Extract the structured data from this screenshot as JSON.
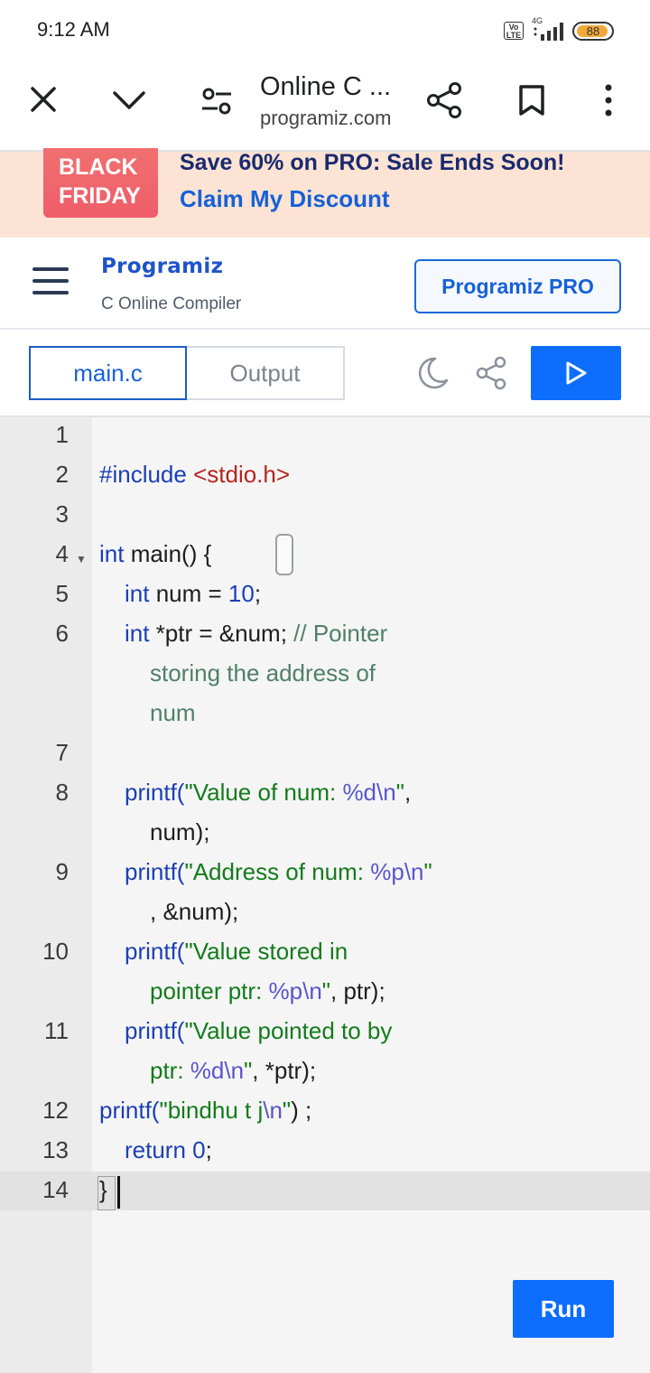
{
  "status_bar": {
    "time": "9:12 AM",
    "volte": "Vo LTE",
    "network": "4G",
    "battery": "88"
  },
  "browser": {
    "title": "Online C ...",
    "url": "programiz.com"
  },
  "promo": {
    "badge_line1": "BLACK",
    "badge_line2": "FRIDAY",
    "text": "Save 60% on PRO: Sale Ends Soon!",
    "link": "Claim My Discount"
  },
  "site": {
    "logo": "Programiz",
    "subtitle": "C Online Compiler",
    "pro_button": "Programiz PRO"
  },
  "tabs": {
    "main": "main.c",
    "output": "Output"
  },
  "editor": {
    "line_numbers": [
      "1",
      "2",
      "3",
      "4",
      "5",
      "6",
      "7",
      "8",
      "9",
      "10",
      "11",
      "12",
      "13",
      "14"
    ],
    "lines": [
      {
        "number": "1",
        "segments": []
      },
      {
        "number": "2",
        "segments": [
          {
            "t": "#include ",
            "c": "pre"
          },
          {
            "t": "<stdio.h>",
            "c": "inc"
          }
        ]
      },
      {
        "number": "3",
        "segments": []
      },
      {
        "number": "4",
        "segments": [
          {
            "t": "int",
            "c": "kw"
          },
          {
            "t": " main() {",
            "c": ""
          }
        ]
      },
      {
        "number": "5",
        "segments": [
          {
            "t": "int",
            "c": "kw"
          },
          {
            "t": " num = ",
            "c": ""
          },
          {
            "t": "10",
            "c": "num"
          },
          {
            "t": ";",
            "c": ""
          }
        ]
      },
      {
        "number": "6",
        "segments": [
          {
            "t": "int",
            "c": "kw"
          },
          {
            "t": " *ptr = &num; ",
            "c": ""
          },
          {
            "t": "// Pointer",
            "c": "cm"
          }
        ]
      },
      {
        "number": "",
        "segments": [
          {
            "t": "storing the address of",
            "c": "cm"
          }
        ]
      },
      {
        "number": "",
        "segments": [
          {
            "t": "num",
            "c": "cm"
          }
        ]
      },
      {
        "number": "7",
        "segments": []
      },
      {
        "number": "8",
        "segments": [
          {
            "t": "printf(",
            "c": "kw"
          },
          {
            "t": "\"Value of num: ",
            "c": "str"
          },
          {
            "t": "%d\\n",
            "c": "esc"
          },
          {
            "t": "\"",
            "c": "str"
          },
          {
            "t": ",",
            "c": ""
          }
        ]
      },
      {
        "number": "",
        "segments": [
          {
            "t": "num);",
            "c": ""
          }
        ]
      },
      {
        "number": "9",
        "segments": [
          {
            "t": "printf(",
            "c": "kw"
          },
          {
            "t": "\"Address of num: ",
            "c": "str"
          },
          {
            "t": "%p\\n",
            "c": "esc"
          },
          {
            "t": "\"",
            "c": "str"
          }
        ]
      },
      {
        "number": "",
        "segments": [
          {
            "t": ", &num);",
            "c": ""
          }
        ]
      },
      {
        "number": "10",
        "segments": [
          {
            "t": "printf(",
            "c": "kw"
          },
          {
            "t": "\"Value stored in",
            "c": "str"
          }
        ]
      },
      {
        "number": "",
        "segments": [
          {
            "t": "pointer ptr: ",
            "c": "str"
          },
          {
            "t": "%p\\n",
            "c": "esc"
          },
          {
            "t": "\"",
            "c": "str"
          },
          {
            "t": ", ptr);",
            "c": ""
          }
        ]
      },
      {
        "number": "11",
        "segments": [
          {
            "t": "printf(",
            "c": "kw"
          },
          {
            "t": "\"Value pointed to by",
            "c": "str"
          }
        ]
      },
      {
        "number": "",
        "segments": [
          {
            "t": "ptr: ",
            "c": "str"
          },
          {
            "t": "%d\\n",
            "c": "esc"
          },
          {
            "t": "\"",
            "c": "str"
          },
          {
            "t": ", *ptr);",
            "c": ""
          }
        ]
      },
      {
        "number": "12",
        "segments": [
          {
            "t": "printf(",
            "c": "kw"
          },
          {
            "t": "\"bindhu t j",
            "c": "str"
          },
          {
            "t": "\\n",
            "c": "esc"
          },
          {
            "t": "\"",
            "c": "str"
          },
          {
            "t": ") ;",
            "c": ""
          }
        ]
      },
      {
        "number": "13",
        "segments": [
          {
            "t": "return",
            "c": "kw"
          },
          {
            "t": " ",
            "c": ""
          },
          {
            "t": "0",
            "c": "num"
          },
          {
            "t": ";",
            "c": ""
          }
        ]
      },
      {
        "number": "14",
        "segments": [
          {
            "t": "}",
            "c": ""
          }
        ]
      }
    ]
  },
  "run_button": "Run",
  "colors": {
    "accent": "#0d6efd",
    "promo_bg": "#fde3d3",
    "badge": "#ef5d6a"
  }
}
